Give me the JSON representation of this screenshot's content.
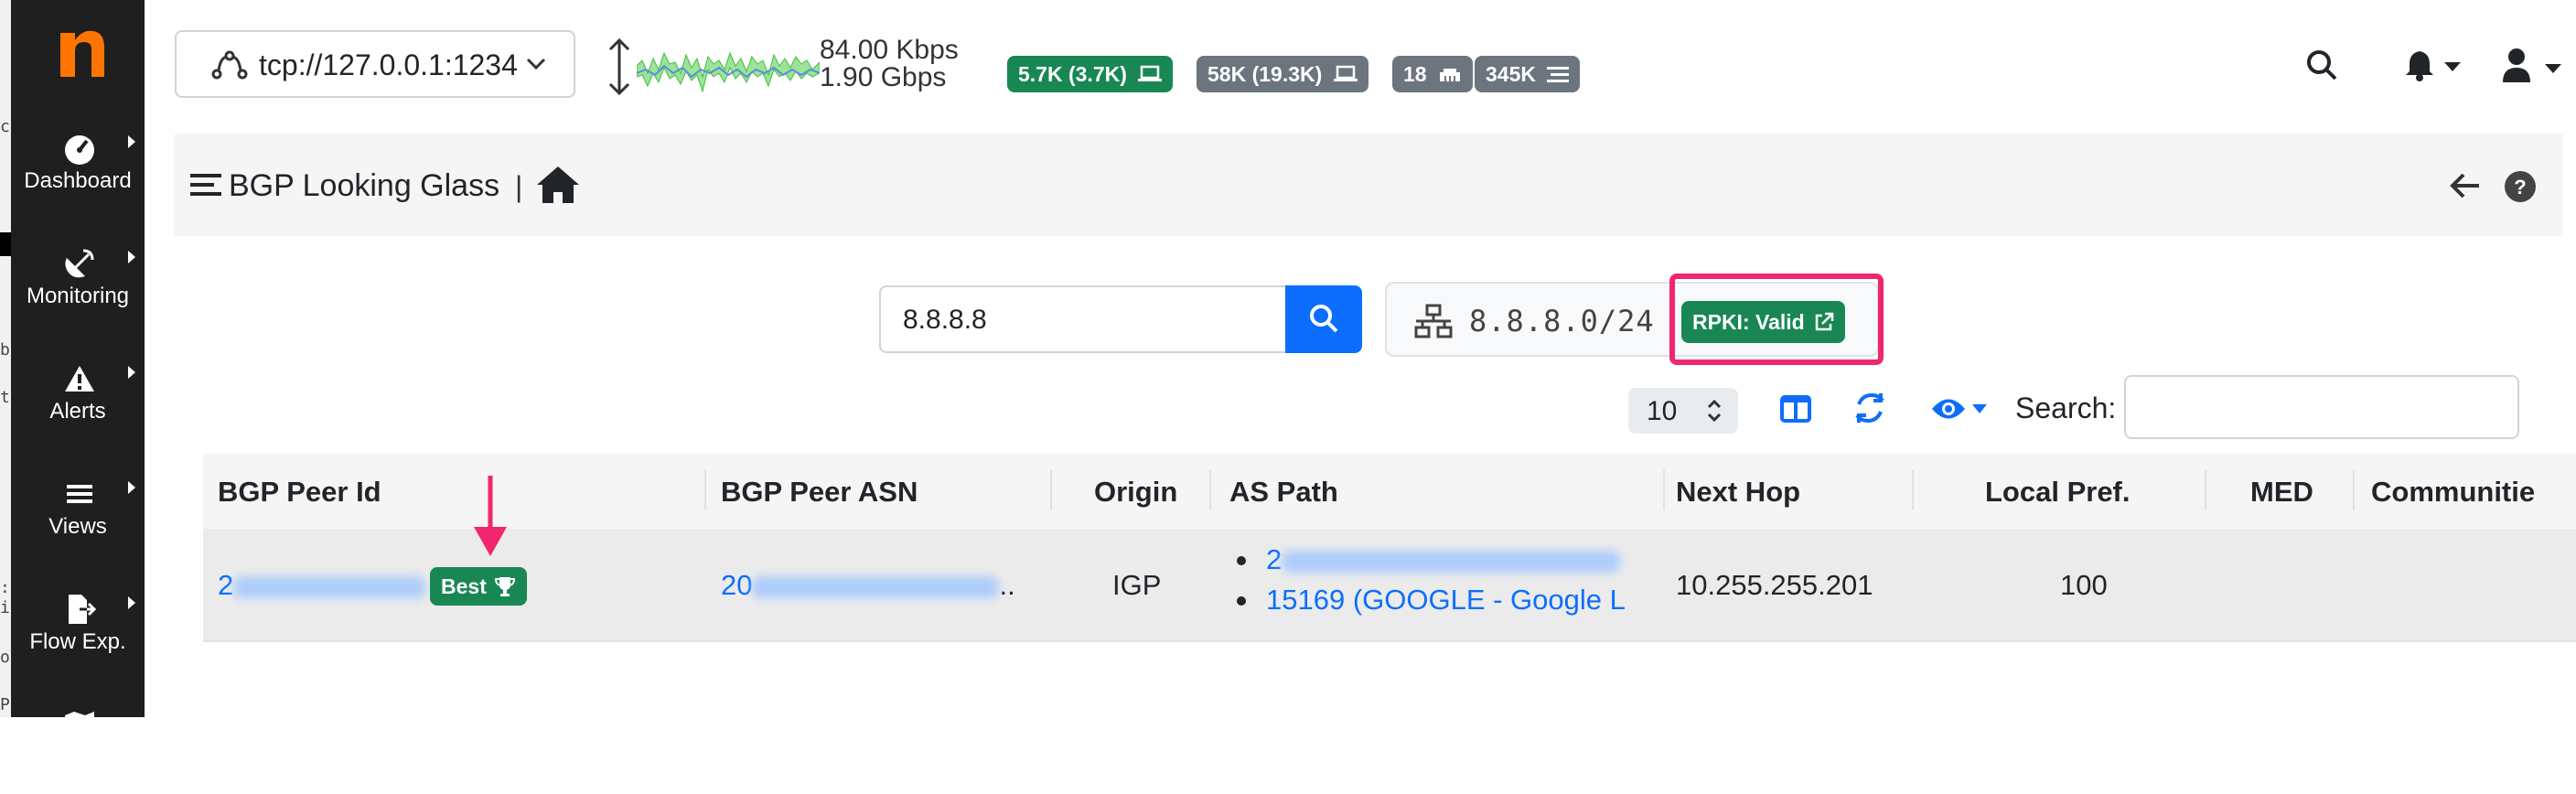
{
  "app": {
    "interface": "tcp://127.0.0.1:1234",
    "rates": {
      "upload": "84.00 Kbps",
      "download": "1.90 Gbps"
    },
    "badges": [
      {
        "label": "5.7K (3.7K)",
        "color": "#198754",
        "icon": "laptop-icon"
      },
      {
        "label": "58K (19.3K)",
        "color": "#6c757d",
        "icon": "laptop-icon"
      },
      {
        "label": "18",
        "color": "#6c757d",
        "icon": "ethernet-icon"
      },
      {
        "label": "345K",
        "color": "#6c757d",
        "icon": "list-icon"
      }
    ]
  },
  "sidebar": {
    "items": [
      {
        "label": "Dashboard",
        "icon": "gauge-icon"
      },
      {
        "label": "Monitoring",
        "icon": "satellite-dish-icon"
      },
      {
        "label": "Alerts",
        "icon": "warning-icon"
      },
      {
        "label": "Views",
        "icon": "bars-icon"
      },
      {
        "label": "Flow Exp.",
        "icon": "file-export-icon"
      }
    ]
  },
  "header": {
    "title": "BGP Looking Glass",
    "separator": "|"
  },
  "search": {
    "value": "8.8.8.8"
  },
  "network": {
    "prefix": "8.8.8.0/24",
    "rpki": "RPKI: Valid"
  },
  "toolbar": {
    "page_length": "10",
    "search_label": "Search:"
  },
  "table": {
    "columns": [
      "BGP Peer Id",
      "BGP Peer ASN",
      "Origin",
      "AS Path",
      "Next Hop",
      "Local Pref.",
      "MED",
      "Communitie"
    ],
    "rows": [
      {
        "peer_id_prefix": "2",
        "best_label": "Best",
        "peer_asn_prefix": "20",
        "peer_asn_suffix": "..",
        "origin": "IGP",
        "as_path": [
          "2",
          "15169 (GOOGLE - Google L"
        ],
        "next_hop": "10.255.255.201",
        "local_pref": "100",
        "med": ""
      }
    ]
  },
  "colors": {
    "accent": "#0d6efd",
    "success": "#198754",
    "highlight": "#f0266e",
    "sidebar": "#1f1f1f",
    "logo": "#ff7500"
  }
}
